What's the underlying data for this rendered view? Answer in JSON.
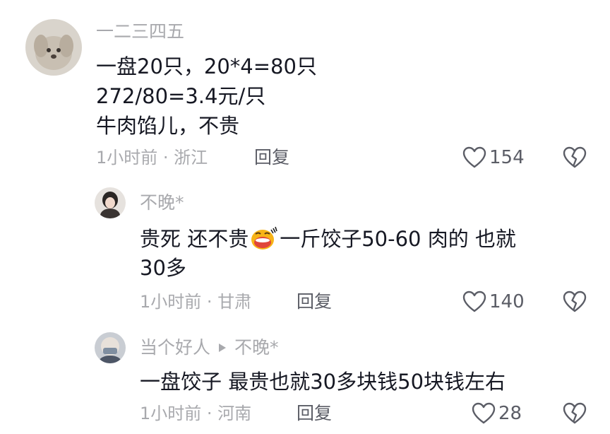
{
  "comments": [
    {
      "username": "一二三四五",
      "lines": [
        "一盘20只，20*4=80只",
        "272/80=3.4元/只",
        "牛肉馅儿，不贵"
      ],
      "meta": "1小时前 · 浙江",
      "reply": "回复",
      "likes": "154"
    },
    {
      "username": "不晚*",
      "line1_before": "贵死 还不贵",
      "emoji": "laughing-face-emoji",
      "line1_after": "一斤饺子50-60  肉的 也就",
      "line2": "30多",
      "meta": "1小时前 · 甘肃",
      "reply": "回复",
      "likes": "140"
    },
    {
      "username": "当个好人",
      "reply_to": "不晚*",
      "line1": "一盘饺子 最贵也就30多块钱50块钱左右",
      "meta": "1小时前 · 河南",
      "reply": "回复",
      "likes": "28"
    }
  ],
  "colors": {
    "secondary": "#a8a9ad",
    "text": "#161823",
    "action": "#5b5d66"
  }
}
